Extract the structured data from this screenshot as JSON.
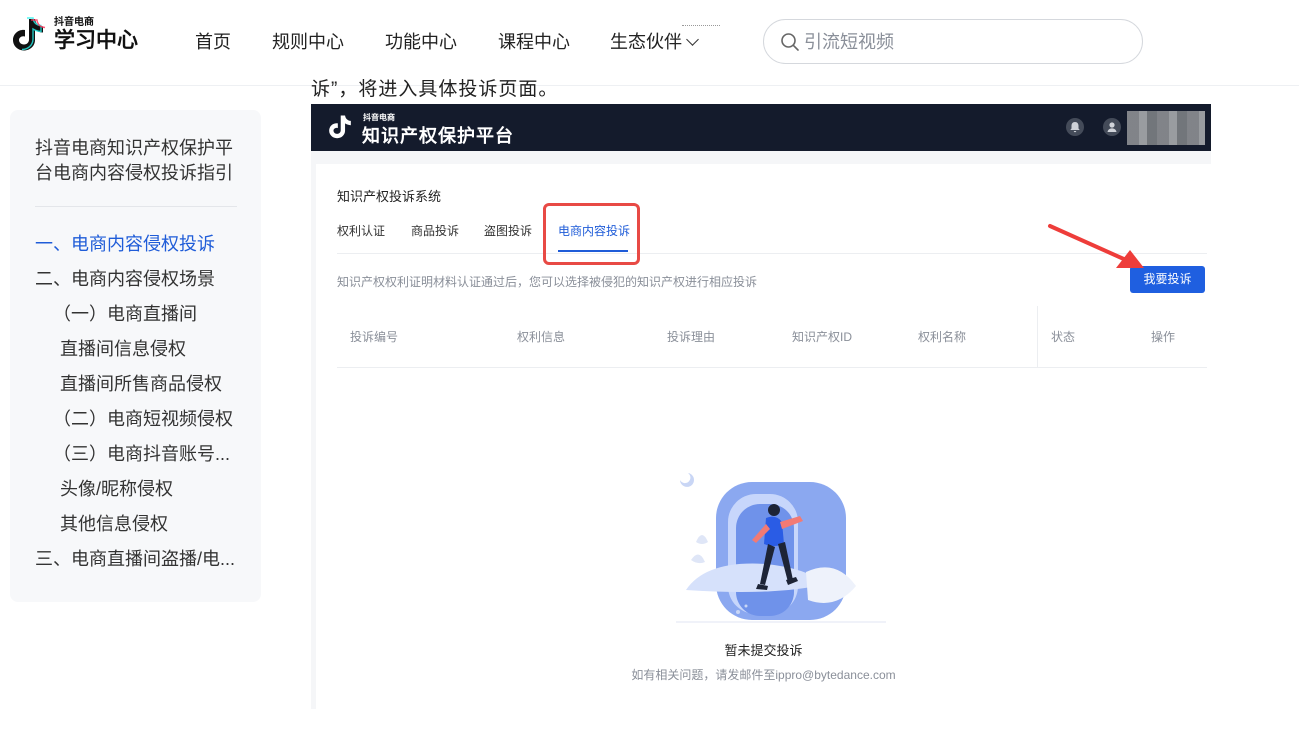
{
  "brand": {
    "small": "抖音电商",
    "title": "学习中心"
  },
  "nav": {
    "items": [
      "首页",
      "规则中心",
      "功能中心",
      "课程中心",
      "生态伙伴"
    ],
    "search_placeholder": "引流短视频"
  },
  "sidebar": {
    "title": "抖音电商知识产权保护平台电商内容侵权投诉指引",
    "toc": [
      {
        "label": "一、电商内容侵权投诉",
        "active": true
      },
      {
        "label": "二、电商内容侵权场景",
        "active": false
      },
      {
        "label": "（一）电商直播间",
        "active": false
      },
      {
        "label": "直播间信息侵权",
        "active": false
      },
      {
        "label": "直播间所售商品侵权",
        "active": false
      },
      {
        "label": "（二）电商短视频侵权",
        "active": false
      },
      {
        "label": "（三）电商抖音账号...",
        "active": false
      },
      {
        "label": "头像/昵称侵权",
        "active": false
      },
      {
        "label": "其他信息侵权",
        "active": false
      },
      {
        "label": "三、电商直播间盗播/电...",
        "active": false
      }
    ],
    "active_color": "#1f5cd8"
  },
  "article": {
    "cut_text": "诉”，将进入具体投诉页面。"
  },
  "shot": {
    "app_small": "抖音电商",
    "app_title": "知识产权保护平台",
    "panel_title": "知识产权投诉系统",
    "tabs": [
      "权利认证",
      "商品投诉",
      "盗图投诉",
      "电商内容投诉"
    ],
    "active_tab": "电商内容投诉",
    "desc": "知识产权权利证明材料认证通过后，您可以选择被侵犯的知识产权进行相应投诉",
    "button": "我要投诉",
    "columns": [
      "投诉编号",
      "权利信息",
      "投诉理由",
      "知识产权ID",
      "权利名称",
      "状态",
      "操作"
    ],
    "empty_title": "暂未提交投诉",
    "empty_sub": "如有相关问题，请发邮件至ippro@bytedance.com",
    "highlight_color": "#e84a45",
    "primary_color": "#1f5fe0"
  }
}
